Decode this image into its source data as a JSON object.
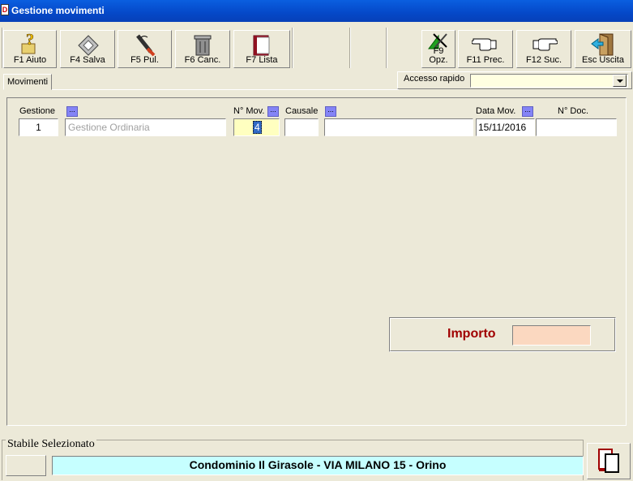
{
  "window": {
    "title": "Gestione movimenti",
    "app_icon": "document-icon"
  },
  "toolbar": {
    "buttons": [
      {
        "label": "F1 Aiuto",
        "icon": "help-icon"
      },
      {
        "label": "F4 Salva",
        "icon": "save-disk-icon"
      },
      {
        "label": "F5 Pul.",
        "icon": "brush-icon"
      },
      {
        "label": "F6 Canc.",
        "icon": "trash-icon"
      },
      {
        "label": "F7 Lista",
        "icon": "book-list-icon"
      },
      {
        "label": "F9\nOpz.",
        "icon": "options-tools-icon"
      },
      {
        "label": "F11 Prec.",
        "icon": "hand-left-icon"
      },
      {
        "label": "F12 Suc.",
        "icon": "hand-right-icon"
      },
      {
        "label": "Esc Uscita",
        "icon": "exit-door-icon"
      }
    ]
  },
  "tabs": [
    {
      "label": "Movimenti",
      "active": true
    }
  ],
  "quick_access": {
    "label": "Accesso rapido",
    "value": ""
  },
  "form": {
    "gestione": {
      "label": "Gestione",
      "code": "1",
      "description": "Gestione Ordinaria"
    },
    "num_mov": {
      "label": "N° Mov.",
      "value": "4"
    },
    "causale": {
      "label": "Causale",
      "code": "",
      "description": ""
    },
    "data_mov": {
      "label": "Data Mov.",
      "value": "15/11/2016"
    },
    "num_doc": {
      "label": "N° Doc.",
      "value": ""
    },
    "lookup_label": "..."
  },
  "importo": {
    "label": "Importo",
    "value": ""
  },
  "status": {
    "legend": "Stabile Selezionato",
    "condominio": "Condominio Il Girasole - VIA MILANO 15 - Orino"
  },
  "colors": {
    "titlebar": "#0548c8",
    "importo_label": "#a00000",
    "importo_field": "#fbd8c0",
    "condominio_field": "#c6ffff",
    "num_mov_field": "#ffffc0",
    "lookup_button": "#8484f6"
  }
}
